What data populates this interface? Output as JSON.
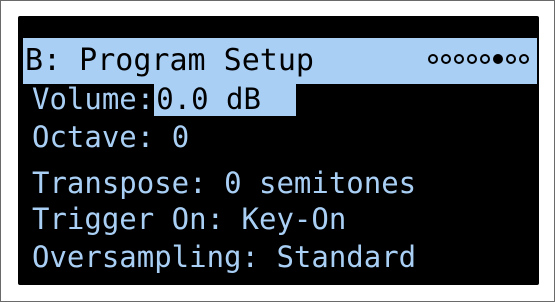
{
  "header": {
    "title": "B: Program Setup",
    "page_count": 8,
    "active_page": 6
  },
  "params": [
    {
      "label": "Volume:",
      "value": "0.0 dB",
      "selected": true
    },
    {
      "label": "Octave:",
      "value": "0",
      "selected": false
    },
    {
      "label": "Transpose:",
      "value": "0 semitones",
      "selected": false
    },
    {
      "label": "Trigger On:",
      "value": "Key-On",
      "selected": false
    },
    {
      "label": "Oversampling:",
      "value": "Standard",
      "selected": false
    }
  ],
  "colors": {
    "screen_bg": "#000000",
    "text": "#a9cff5",
    "highlight": "#a9cff5"
  }
}
